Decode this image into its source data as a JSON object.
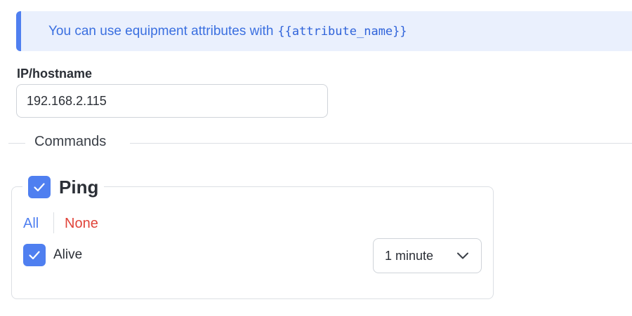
{
  "info": {
    "text": "You can use equipment attributes with",
    "code": "{{attribute_name}}",
    "accent_color": "#4f7ff0",
    "background_color": "#eaf0fd"
  },
  "ip_field": {
    "label": "IP/hostname",
    "value": "192.168.2.115"
  },
  "commands": {
    "section_title": "Commands",
    "ping": {
      "title": "Ping",
      "checked": true,
      "icon": "checkmark-icon",
      "select_all_label": "All",
      "select_none_label": "None",
      "items": [
        {
          "label": "Alive",
          "checked": true,
          "interval": "1 minute",
          "interval_icon": "chevron-down-icon"
        }
      ]
    }
  },
  "colors": {
    "link_all": "#4f7ff0",
    "link_none": "#e0443a",
    "checkbox": "#4f7ff0"
  }
}
